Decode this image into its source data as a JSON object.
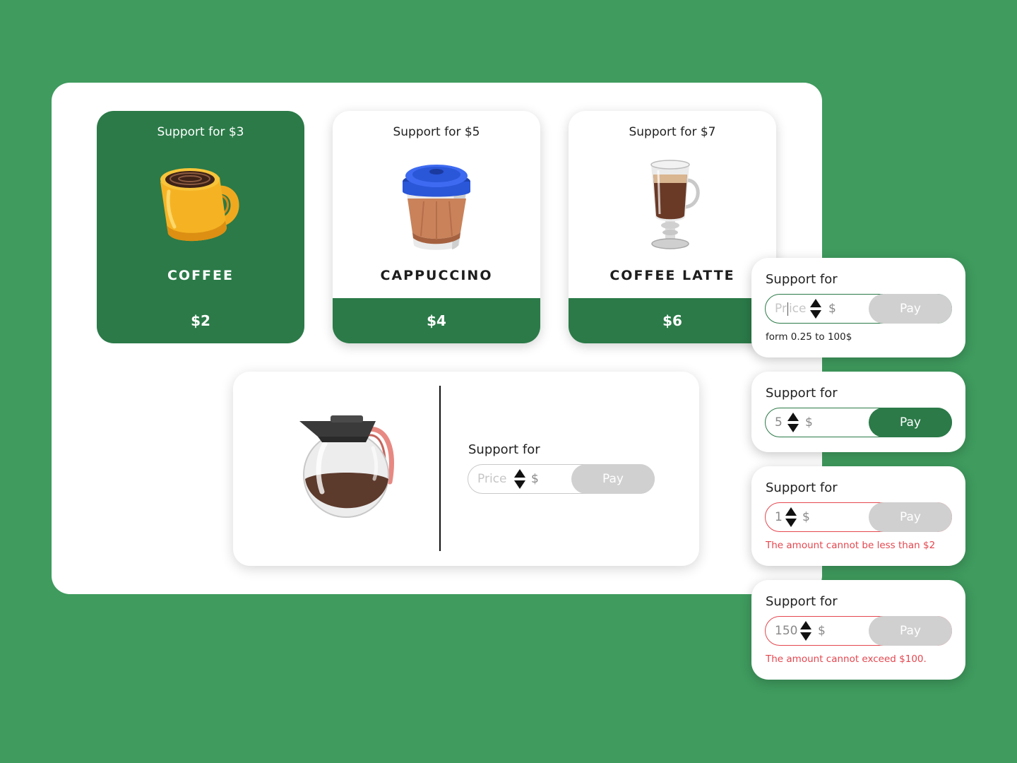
{
  "colors": {
    "background": "#3f9b5e",
    "brand_green": "#2b7a48",
    "disabled_gray": "#d0d0d0",
    "error_red": "#e4474f",
    "panel": "#ffffff"
  },
  "cards": [
    {
      "support": "Support for $3",
      "name": "COFFEE",
      "price": "$2",
      "icon": "coffee-mug-icon",
      "selected": true
    },
    {
      "support": "Support for $5",
      "name": "CAPPUCCINO",
      "price": "$4",
      "icon": "takeaway-cup-icon",
      "selected": false
    },
    {
      "support": "Support for $7",
      "name": "COFFEE LATTE",
      "price": "$6",
      "icon": "latte-glass-icon",
      "selected": false
    }
  ],
  "custom_panel": {
    "icon": "coffee-pot-icon",
    "label": "Support for",
    "placeholder": "Price",
    "currency": "$",
    "pay_label": "Pay"
  },
  "widgets": [
    {
      "label": "Support for",
      "value": "Pr",
      "value_after_caret": "ice",
      "currency": "$",
      "pay_label": "Pay",
      "note": "form 0.25 to 100$",
      "state": "focused"
    },
    {
      "label": "Support for",
      "value": "5",
      "currency": "$",
      "pay_label": "Pay",
      "state": "valid"
    },
    {
      "label": "Support for",
      "value": "1",
      "currency": "$",
      "pay_label": "Pay",
      "note": "The amount cannot be less than $2",
      "state": "error"
    },
    {
      "label": "Support for",
      "value": "150",
      "currency": "$",
      "pay_label": "Pay",
      "note": "The amount cannot exceed $100.",
      "state": "error"
    }
  ]
}
